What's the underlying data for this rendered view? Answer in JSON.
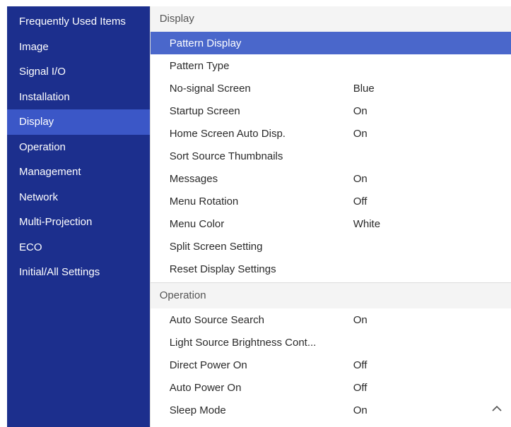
{
  "sidebar": {
    "items": [
      {
        "label": "Frequently Used Items",
        "active": false
      },
      {
        "label": "Image",
        "active": false
      },
      {
        "label": "Signal I/O",
        "active": false
      },
      {
        "label": "Installation",
        "active": false
      },
      {
        "label": "Display",
        "active": true
      },
      {
        "label": "Operation",
        "active": false
      },
      {
        "label": "Management",
        "active": false
      },
      {
        "label": "Network",
        "active": false
      },
      {
        "label": "Multi-Projection",
        "active": false
      },
      {
        "label": "ECO",
        "active": false
      },
      {
        "label": "Initial/All Settings",
        "active": false
      }
    ]
  },
  "display_section": {
    "header": "Display",
    "rows": [
      {
        "label": "Pattern Display",
        "value": "",
        "active": true
      },
      {
        "label": "Pattern Type",
        "value": ""
      },
      {
        "label": "No-signal Screen",
        "value": "Blue"
      },
      {
        "label": "Startup Screen",
        "value": "On"
      },
      {
        "label": "Home Screen Auto Disp.",
        "value": "On"
      },
      {
        "label": "Sort Source Thumbnails",
        "value": ""
      },
      {
        "label": "Messages",
        "value": "On"
      },
      {
        "label": "Menu Rotation",
        "value": "Off"
      },
      {
        "label": "Menu Color",
        "value": "White"
      },
      {
        "label": "Split Screen Setting",
        "value": ""
      },
      {
        "label": "Reset Display Settings",
        "value": ""
      }
    ]
  },
  "operation_section": {
    "header": "Operation",
    "rows": [
      {
        "label": "Auto Source Search",
        "value": "On"
      },
      {
        "label": "Light Source Brightness Cont...",
        "value": ""
      },
      {
        "label": "Direct Power On",
        "value": "Off"
      },
      {
        "label": "Auto Power On",
        "value": "Off"
      },
      {
        "label": "Sleep Mode",
        "value": "On"
      }
    ]
  },
  "colors": {
    "sidebar_bg": "#1c2f8d",
    "sidebar_active": "#3b57c7",
    "row_active": "#4a67cb"
  },
  "icons": {
    "scroll_up": "chevron-up-icon"
  }
}
